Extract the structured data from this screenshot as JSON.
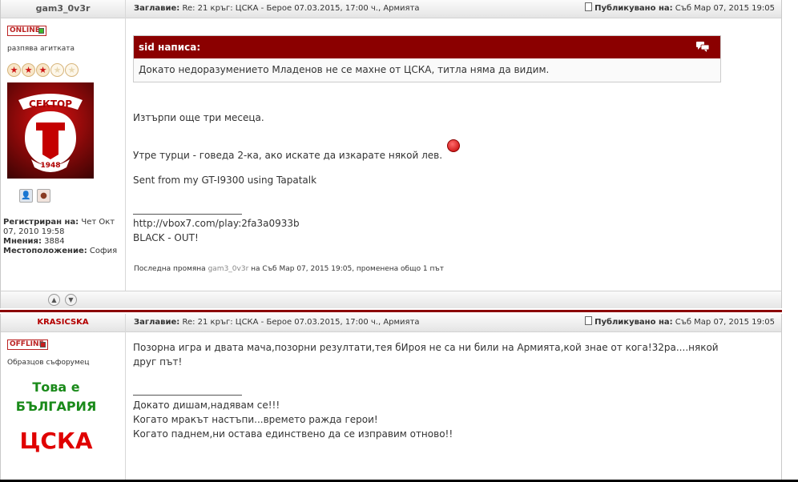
{
  "posts": [
    {
      "username": "gam3_0v3r",
      "status": "ONLINE",
      "rank": "разпява агитката",
      "stars": [
        true,
        true,
        true,
        false,
        false
      ],
      "registered_label": "Регистриран на:",
      "registered_value": "Чет Окт 07, 2010 19:58",
      "posts_label": "Мнения:",
      "posts_value": "3884",
      "location_label": "Местоположение:",
      "location_value": "София",
      "title_label": "Заглавие:",
      "title_value": "Re: 21 кръг: ЦСКА - Берое 07.03.2015, 17:00 ч., Армията",
      "published_label": "Публикувано на:",
      "published_value": "Съб Мар 07, 2015 19:05",
      "quote_author": "sid написа:",
      "quote_text": "Докато недоразумението Младенов не се махне от ЦСКА, титла няма да видим.",
      "lines": [
        "Изтърпи още три месеца.",
        "Утре турци - говеда 2-ка, ако искате да изкарате някой лев.",
        "Sent from my GT-I9300 using Tapatalk"
      ],
      "signature": [
        "http://vbox7.com/play:2fa3a0933b",
        "BLACK - OUT!"
      ],
      "edited_prefix": "Последна промяна",
      "edited_user": "gam3_0v3r",
      "edited_suffix": "на Съб Мар 07, 2015 19:05, променена общо 1 път"
    },
    {
      "username": "KRASICSKA",
      "status": "OFFLINE",
      "rank": "Образцов съфорумец",
      "banner_line1": "Това е",
      "banner_line2": "БЪЛГАРИЯ",
      "banner_line3": "ЦСКА",
      "title_label": "Заглавие:",
      "title_value": "Re: 21 кръг: ЦСКА - Берое 07.03.2015, 17:00 ч., Армията",
      "published_label": "Публикувано на:",
      "published_value": "Съб Мар 07, 2015 19:05",
      "body_line1": "Позорна игра и двата мача,позорни резултати,тея бИроя не са ни били на Армията,кой знае от кога!32ра....някой",
      "body_line2": "друг път!",
      "signature": [
        "Докато дишам,надявам се!!!",
        "Когато мракът настъпи...времето ражда герои!",
        "Когато паднем,ни остава единствено да се изправим отново!!"
      ]
    }
  ],
  "avatar_text_top": "СЕКТОР",
  "avatar_text_bottom": "1948",
  "colors": {
    "accent": "#8b0000",
    "online": "#3bbb2a",
    "offline": "#c81e1e"
  }
}
